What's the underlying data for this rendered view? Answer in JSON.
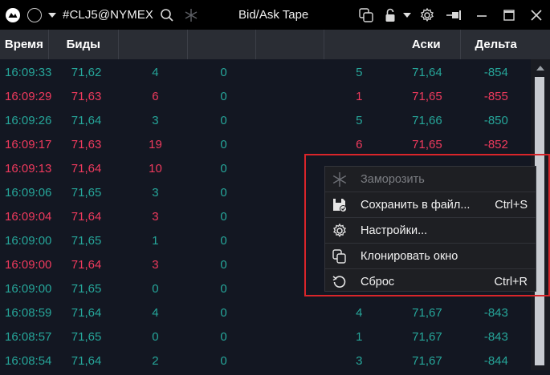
{
  "titlebar": {
    "symbol": "#CLJ5@NYMEX",
    "title": "Bid/Ask Tape",
    "icons": [
      "app-logo-icon",
      "circle-icon",
      "caret-down-icon",
      "search-icon",
      "snowflake-icon",
      "clone-icon",
      "lock-icon",
      "caret-down-icon",
      "gear-icon",
      "pin-icon",
      "minimize-icon",
      "maximize-icon",
      "close-icon"
    ]
  },
  "columns": [
    "Время",
    "Биды",
    "",
    "",
    "",
    "Аски",
    "Дельта"
  ],
  "rows": [
    {
      "time": "16:09:33",
      "bid": "71,62",
      "bq": "4",
      "e1": "0",
      "aq": "5",
      "ask": "71,64",
      "delta": "-854",
      "side": "green"
    },
    {
      "time": "16:09:29",
      "bid": "71,63",
      "bq": "6",
      "e1": "0",
      "aq": "1",
      "ask": "71,65",
      "delta": "-855",
      "side": "red"
    },
    {
      "time": "16:09:26",
      "bid": "71,64",
      "bq": "3",
      "e1": "0",
      "aq": "5",
      "ask": "71,66",
      "delta": "-850",
      "side": "green"
    },
    {
      "time": "16:09:17",
      "bid": "71,63",
      "bq": "19",
      "e1": "0",
      "aq": "6",
      "ask": "71,65",
      "delta": "-852",
      "side": "red"
    },
    {
      "time": "16:09:13",
      "bid": "71,64",
      "bq": "10",
      "e1": "0",
      "aq": "",
      "ask": "",
      "delta": "",
      "side": "red"
    },
    {
      "time": "16:09:06",
      "bid": "71,65",
      "bq": "3",
      "e1": "0",
      "aq": "",
      "ask": "",
      "delta": "",
      "side": "green"
    },
    {
      "time": "16:09:04",
      "bid": "71,64",
      "bq": "3",
      "e1": "0",
      "aq": "",
      "ask": "",
      "delta": "",
      "side": "red"
    },
    {
      "time": "16:09:00",
      "bid": "71,65",
      "bq": "1",
      "e1": "0",
      "aq": "",
      "ask": "",
      "delta": "",
      "side": "green"
    },
    {
      "time": "16:09:00",
      "bid": "71,64",
      "bq": "3",
      "e1": "0",
      "aq": "",
      "ask": "",
      "delta": "",
      "side": "red"
    },
    {
      "time": "16:09:00",
      "bid": "71,65",
      "bq": "0",
      "e1": "0",
      "aq": "",
      "ask": "",
      "delta": "",
      "side": "green"
    },
    {
      "time": "16:08:59",
      "bid": "71,64",
      "bq": "4",
      "e1": "0",
      "aq": "4",
      "ask": "71,67",
      "delta": "-843",
      "side": "green"
    },
    {
      "time": "16:08:57",
      "bid": "71,65",
      "bq": "0",
      "e1": "0",
      "aq": "1",
      "ask": "71,67",
      "delta": "-843",
      "side": "green"
    },
    {
      "time": "16:08:54",
      "bid": "71,64",
      "bq": "2",
      "e1": "0",
      "aq": "3",
      "ask": "71,67",
      "delta": "-844",
      "side": "green"
    }
  ],
  "menu": {
    "items": [
      {
        "label": "Заморозить",
        "shortcut": "",
        "icon": "snowflake-icon",
        "disabled": true
      },
      {
        "label": "Сохранить в файл...",
        "shortcut": "Ctrl+S",
        "icon": "save-icon",
        "disabled": false
      },
      {
        "label": "Настройки...",
        "shortcut": "",
        "icon": "gear-icon",
        "disabled": false
      },
      {
        "label": "Клонировать окно",
        "shortcut": "",
        "icon": "clone-icon",
        "disabled": false
      },
      {
        "label": "Сброс",
        "shortcut": "Ctrl+R",
        "icon": "reset-icon",
        "disabled": false
      }
    ]
  },
  "colors": {
    "buy": "#26a69a",
    "sell": "#ef3a5d",
    "highlight": "#d9252a"
  }
}
